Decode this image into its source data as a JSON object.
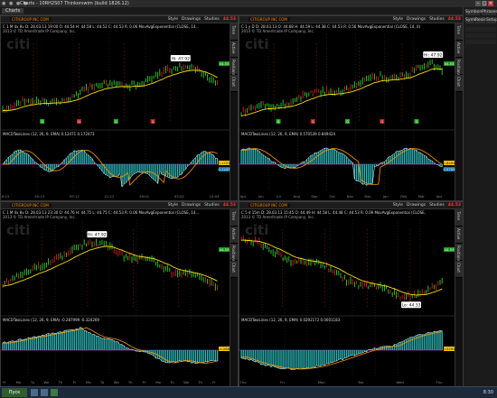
{
  "window": {
    "title": "Charts - 10RH2S07 Thinkorswim (build 1826.12)",
    "min": "–",
    "max": "□",
    "close": "×"
  },
  "tabs": [
    {
      "label": "Charts"
    }
  ],
  "right_toolbar": {
    "row1": [
      "Symbols",
      "Phrases"
    ],
    "row2": [
      "Symbol",
      "Resist",
      "Setup"
    ]
  },
  "taskbar": {
    "start": "Пуск",
    "clock": "8:30"
  },
  "panels": [
    {
      "symbol": "CITIGROUP INC COM",
      "price": "44.53",
      "tools": [
        "Style",
        "Drawings",
        "Studies"
      ],
      "info": "C 1 M 4x 8v  D: 28.03.13 19:00  O: 44.54  H: 44.58  L: 44.52  C: 44.53  R: 0.06  MovAvgExponential (CLOSE, 14...",
      "company": "2013 © TD Ameritrade IP Company, Inc.",
      "logo": "citi",
      "callout": "Hi: 47.92",
      "macd": "MACDTwoLines (12, 26, 9, EMA)  0.12471  0.172473",
      "right_labels": [
        "44.53",
        "0.1725",
        "0.1247"
      ],
      "x_labels": [
        "16:15",
        "20:13",
        "05:12",
        "21:12",
        "29:01",
        "03:02",
        "10:04"
      ],
      "side": [
        "Time",
        "Active",
        "Positions",
        "Chart"
      ],
      "signals": [
        "Q",
        "Q",
        "Q",
        "Q"
      ]
    },
    {
      "symbol": "CITIGROUP INC COM",
      "price": "44.53",
      "tools": [
        "Style",
        "Drawings",
        "Studies"
      ],
      "info": "C 1 y D  D: 28.03.13  O: 44.68  H: 44.59  L: 44.38  C: 44.53  R: 0.56  MovAvgExponential (CLOSE, 14, 0)",
      "company": "2013 © TD Ameritrade IP Company, Inc.",
      "logo": "citi",
      "callout": "Hi: 47.92",
      "macd": "MACDTwoLines (12, 26, 9, EMA)  0.570539  0.849424",
      "right_labels": [
        "44.53",
        "0.8494",
        "0.5705"
      ],
      "x_labels": [
        "Apr",
        "Jun",
        "Jul",
        "Aug",
        "Sep",
        "Oct",
        "Nov",
        "Dec",
        "Jan",
        "Feb",
        "Mar",
        "Apr"
      ],
      "side": [
        "Time",
        "Active",
        "Positions",
        "Chart"
      ],
      "signals": [
        "Q",
        "Q",
        "Q",
        "Q",
        "Q"
      ]
    },
    {
      "symbol": "CITIGROUP INC COM",
      "price": "44.53",
      "tools": [
        "Style",
        "Drawings",
        "Studies"
      ],
      "info": "C 1 M 4x 8v  D: 28.03.13 23:30  O: 44.76  H: 44.75  L: 44.75  C: 44.53  R: 0.06  MovAvgExponential (CLOSE, 14...",
      "company": "2013 © TD Ameritrade IP Company, Inc.",
      "logo": "citi",
      "callout": "Hi: 47.92",
      "macd": "MACDTwoLines (12, 26, 9, EMA)  -0.287999  -0.324269",
      "right_labels": [
        "44.53",
        "-0.288"
      ],
      "x_labels": [
        "Fr",
        "Mo",
        "Tu",
        "We",
        "Th",
        "Fr",
        "Mo",
        "Tu",
        "We",
        "Th",
        "Fr",
        "Mo",
        "Tu",
        "We",
        "Th",
        "Fr"
      ],
      "side": [
        "Time",
        "Active",
        "Positions",
        "Chart"
      ],
      "signals": []
    },
    {
      "symbol": "CITIGROUP INC COM",
      "price": "44.53",
      "tools": [
        "Style",
        "Drawings",
        "Studies"
      ],
      "info": "C 5 d 15m  D: 28.03.13 15:45  O: 44.49  H: 44.58  L: 44.48  C: 44.53  R: 0.09  MovAvgExponential (CLOSE, 14, 0)",
      "company": "2013 © TD Ameritrade IP Company, Inc.",
      "logo": "citi",
      "callout": "Lo: 44.33",
      "macd": "MACDTwoLines (12, 26, 9, EMA)  0.0292172  0.0001183",
      "right_labels": [
        "44.53",
        "0.0292"
      ],
      "x_labels": [
        "Thu",
        "Fri",
        "Mon",
        "Tue",
        "Wed",
        "Thu"
      ],
      "side": [
        "Time",
        "Active",
        "Positions",
        "Chart"
      ],
      "signals": []
    }
  ],
  "colors": {
    "up": "#33cc33",
    "down": "#cc2222",
    "ema": "#ffdd00",
    "hist": "#2bb5b5",
    "signal": "#ff9900",
    "macd_line": "#ffffff",
    "zero": "#ff33ff",
    "price_label_bg": "#1a9a1a",
    "macd_label_bg": "#ffcc00",
    "macd_label_bg2": "#1177aa"
  }
}
